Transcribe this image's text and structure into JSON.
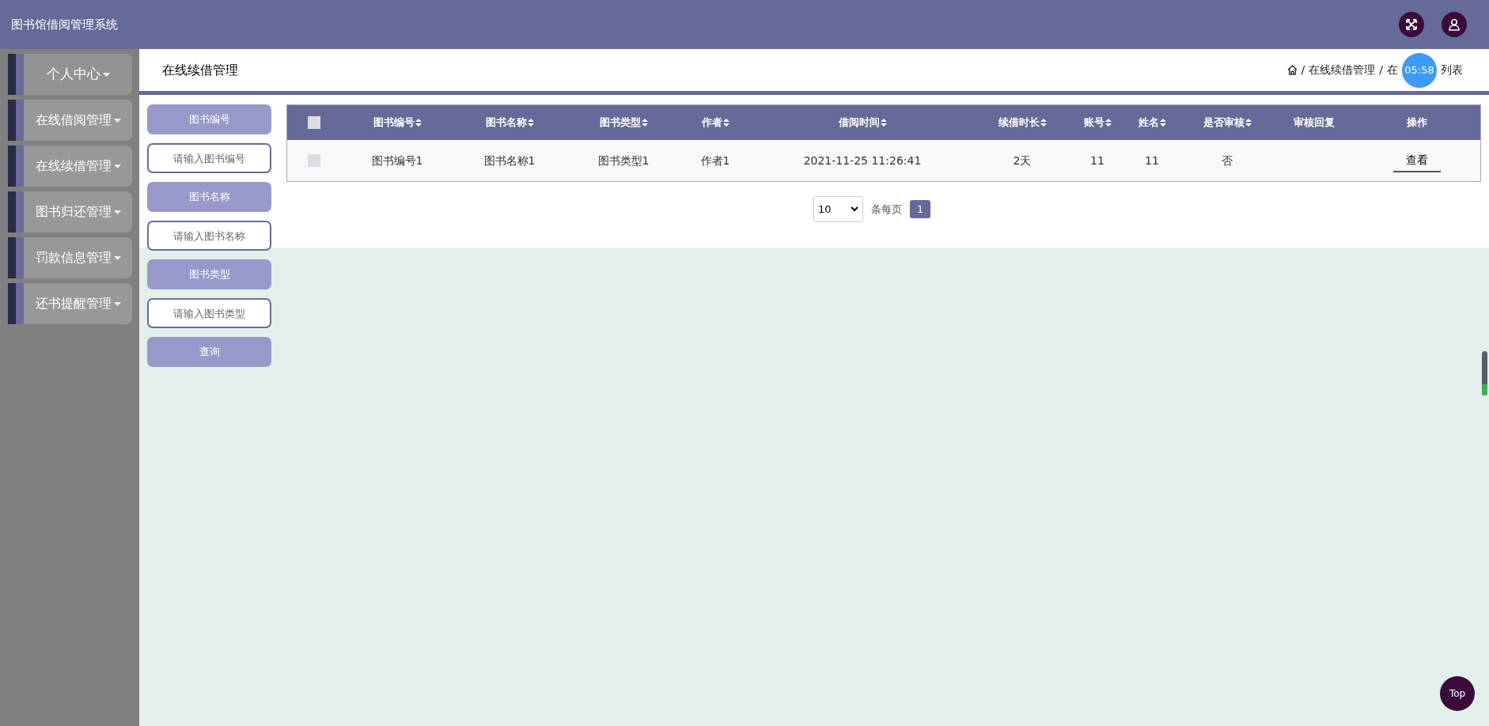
{
  "app_title": "图书馆借阅管理系统",
  "sidebar": {
    "items": [
      {
        "label": "个人中心",
        "selected": true
      },
      {
        "label": "在线借阅管理",
        "selected": false
      },
      {
        "label": "在线续借管理",
        "selected": false
      },
      {
        "label": "图书归还管理",
        "selected": false
      },
      {
        "label": "罚款信息管理",
        "selected": false
      },
      {
        "label": "还书提醒管理",
        "selected": false
      }
    ]
  },
  "page_title": "在线续借管理",
  "breadcrumb": {
    "separator": "/",
    "items": [
      "在线续借管理",
      "在"
    ],
    "after_timer": "列表"
  },
  "timer": "05:58",
  "filters": [
    {
      "label": "图书编号",
      "placeholder": "请输入图书编号"
    },
    {
      "label": "图书名称",
      "placeholder": "请输入图书名称"
    },
    {
      "label": "图书类型",
      "placeholder": "请输入图书类型"
    }
  ],
  "search_button": "查询",
  "table": {
    "all_selected": false,
    "columns": [
      {
        "label": "图书编号",
        "sortable": true
      },
      {
        "label": "图书名称",
        "sortable": true
      },
      {
        "label": "图书类型",
        "sortable": true
      },
      {
        "label": "作者",
        "sortable": true
      },
      {
        "label": "借阅时间",
        "sortable": true
      },
      {
        "label": "续借时长",
        "sortable": true
      },
      {
        "label": "账号",
        "sortable": true
      },
      {
        "label": "姓名",
        "sortable": true
      },
      {
        "label": "是否审核",
        "sortable": true
      },
      {
        "label": "审核回复",
        "sortable": false
      },
      {
        "label": "操作",
        "sortable": false
      }
    ],
    "rows": [
      {
        "checked": false,
        "cells": [
          "图书编号1",
          "图书名称1",
          "图书类型1",
          "作者1",
          "2021-11-25 11:26:41",
          "2天",
          "11",
          "11",
          "否",
          ""
        ],
        "action": "查看"
      }
    ]
  },
  "pagination": {
    "page_size": "10",
    "page_size_label": "条每页",
    "pages": [
      {
        "label": "1",
        "selected": true
      }
    ]
  },
  "top_button": "Top"
}
